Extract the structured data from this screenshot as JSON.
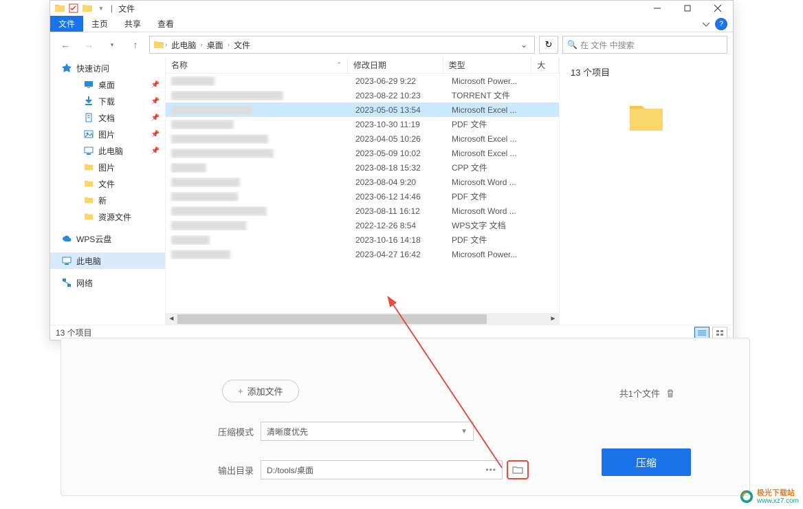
{
  "titlebar": {
    "title": "文件",
    "sep": "|"
  },
  "window_controls": {
    "minimize": "—",
    "maximize": "□",
    "close": "✕"
  },
  "tabs": {
    "file": "文件",
    "home": "主页",
    "share": "共享",
    "view": "查看"
  },
  "nav": {
    "back": "←",
    "forward": "→",
    "up": "↑"
  },
  "breadcrumb": {
    "root": "此电脑",
    "seg1": "桌面",
    "seg2": "文件",
    "arrow": "›"
  },
  "search": {
    "placeholder": "在 文件 中搜索"
  },
  "sidebar": {
    "quick_access": "快速访问",
    "desktop": "桌面",
    "downloads": "下载",
    "documents": "文档",
    "pictures": "图片",
    "this_pc": "此电脑",
    "folder_pictures": "图片",
    "folder_files": "文件",
    "folder_new": "新",
    "folder_resources": "资源文件",
    "wps_cloud": "WPS云盘",
    "this_pc2": "此电脑",
    "network": "网络"
  },
  "columns": {
    "name": "名称",
    "date_modified": "修改日期",
    "type": "类型",
    "size": "大"
  },
  "files": [
    {
      "date": "2023-06-29 9:22",
      "type": "Microsoft Power..."
    },
    {
      "date": "2023-08-22 10:23",
      "type": "TORRENT 文件"
    },
    {
      "date": "2023-05-05 13:54",
      "type": "Microsoft Excel ...",
      "selected": true
    },
    {
      "date": "2023-10-30 11:19",
      "type": "PDF 文件"
    },
    {
      "date": "2023-04-05 10:26",
      "type": "Microsoft Excel ..."
    },
    {
      "date": "2023-05-09 10:02",
      "type": "Microsoft Excel ..."
    },
    {
      "date": "2023-08-18 15:32",
      "type": "CPP 文件"
    },
    {
      "date": "2023-08-04 9:20",
      "type": "Microsoft Word ..."
    },
    {
      "date": "2023-06-12 14:46",
      "type": "PDF 文件"
    },
    {
      "date": "2023-08-11 16:12",
      "type": "Microsoft Word ..."
    },
    {
      "date": "2022-12-26 8:54",
      "type": "WPS文字 文档"
    },
    {
      "date": "2023-10-16 14:18",
      "type": "PDF 文件"
    },
    {
      "date": "2023-04-27 16:42",
      "type": "Microsoft Power..."
    }
  ],
  "preview": {
    "count_label": "13 个项目"
  },
  "statusbar": {
    "items": "13 个项目"
  },
  "dialog": {
    "add_files": "添加文件",
    "file_count": "共1个文件",
    "mode_label": "压缩模式",
    "mode_value": "清晰度优先",
    "output_label": "输出目录",
    "output_value": "D:/tools/桌面",
    "compress_btn": "压缩"
  },
  "watermark": {
    "line1": "极光下载站",
    "line2": "www.xz7.com"
  }
}
